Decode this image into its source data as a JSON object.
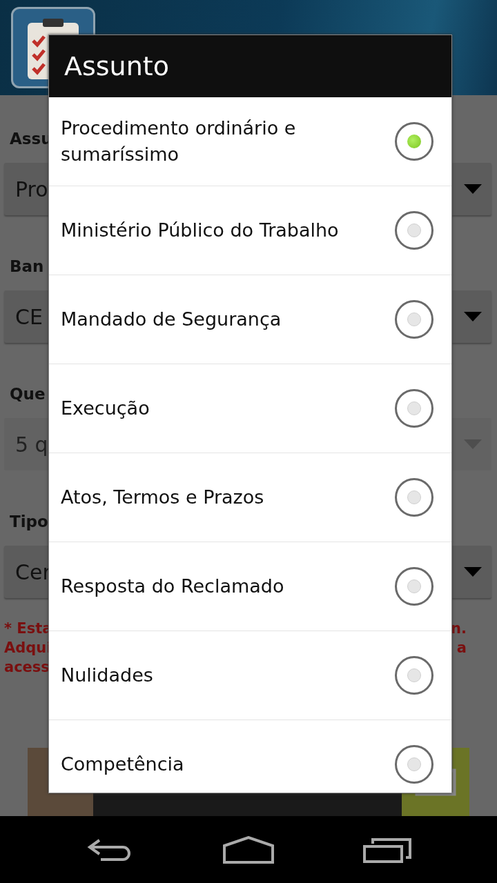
{
  "form": {
    "fields": [
      {
        "label": "Assu",
        "value": "Pro",
        "disabled": false
      },
      {
        "label": "Ban",
        "value": "CE",
        "disabled": false
      },
      {
        "label": "Que",
        "value": "5 q",
        "disabled": true
      },
      {
        "label": "Tipo",
        "value": "Cer",
        "disabled": false
      }
    ]
  },
  "notice": {
    "left_lines": [
      "* Esta",
      "Adqui",
      "acess"
    ],
    "right_lines": [
      "n.",
      "a"
    ]
  },
  "dialog": {
    "title": "Assunto",
    "options": [
      {
        "label": "Procedimento ordinário e sumaríssimo",
        "selected": true
      },
      {
        "label": "Ministério Público do Trabalho",
        "selected": false
      },
      {
        "label": "Mandado de Segurança",
        "selected": false
      },
      {
        "label": "Execução",
        "selected": false
      },
      {
        "label": "Atos, Termos e Prazos",
        "selected": false
      },
      {
        "label": "Resposta do Reclamado",
        "selected": false
      },
      {
        "label": "Nulidades",
        "selected": false
      },
      {
        "label": "Competência",
        "selected": false
      }
    ]
  }
}
